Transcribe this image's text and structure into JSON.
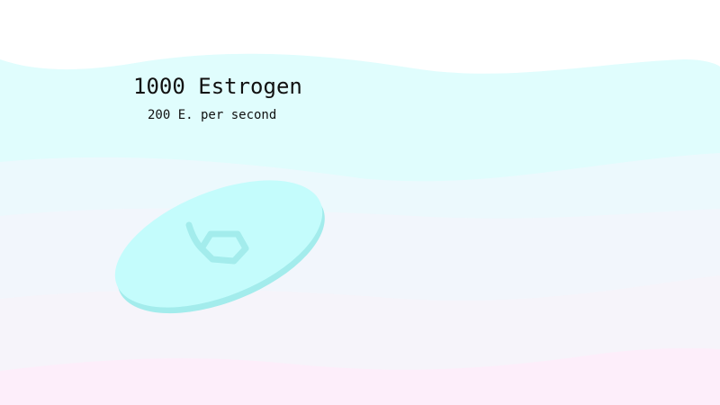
{
  "game": {
    "count_text": "1000 Estrogen",
    "rate_text": "200 E. per second"
  },
  "pill": {
    "icon": "estrogen-pill-icon"
  },
  "colors": {
    "band_top": "#e0fdfd",
    "band_mid": "#ecf9fd",
    "band_low": "#f2f6fc",
    "band_lower": "#f6f4fa",
    "band_bottom": "#fdeefa",
    "pill_face": "#c4fcfc",
    "pill_edge": "#a3ecec",
    "pill_symbol": "#a3ecec"
  }
}
